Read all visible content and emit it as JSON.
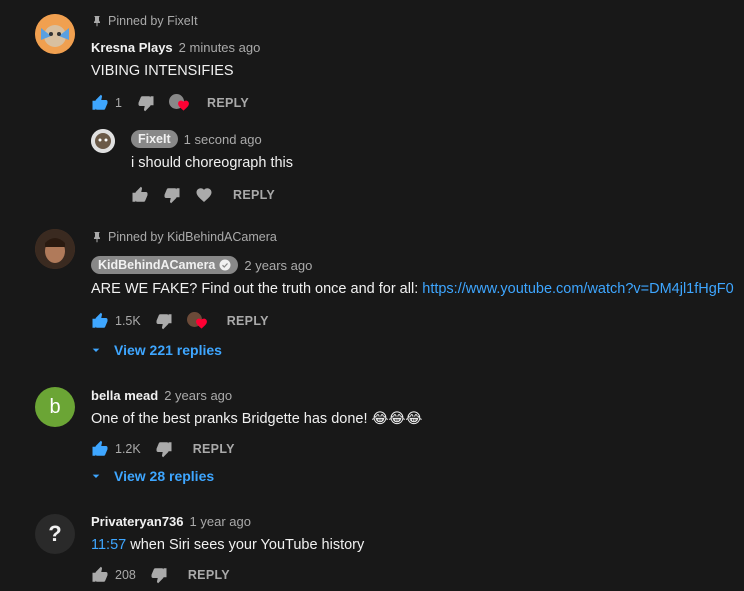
{
  "colors": {
    "background": "#181818",
    "link": "#3ea6ff",
    "like_active": "#3ea6ff",
    "heart": "#ff0033"
  },
  "comments": [
    {
      "pinned_text": "Pinned by FixeIt",
      "author": "Kresna Plays",
      "time": "2 minutes ago",
      "text": "VIBING INTENSIFIES",
      "likes": "1",
      "reply_label": "REPLY",
      "replies": [
        {
          "author": "FixeIt",
          "time": "1 second ago",
          "text": "i should choreograph this",
          "reply_label": "REPLY"
        }
      ]
    },
    {
      "pinned_text": "Pinned by KidBehindACamera",
      "author": "KidBehindACamera",
      "time": "2 years ago",
      "text": "ARE WE FAKE? Find out the truth once and for all: ",
      "link": "https://www.youtube.com/watch?v=DM4jl1fHgF0",
      "likes": "1.5K",
      "reply_label": "REPLY",
      "view_replies": "View 221 replies"
    },
    {
      "avatar_letter": "b",
      "author": "bella mead",
      "time": "2 years ago",
      "text": "One of the best pranks Bridgette has done! 😂😂😂",
      "likes": "1.2K",
      "reply_label": "REPLY",
      "view_replies": "View 28 replies"
    },
    {
      "avatar_letter": "?",
      "author": "Privateryan736",
      "time": "1 year ago",
      "timestamp_link": "11:57",
      "text": " when Siri sees your YouTube history",
      "likes": "208",
      "reply_label": "REPLY"
    }
  ]
}
